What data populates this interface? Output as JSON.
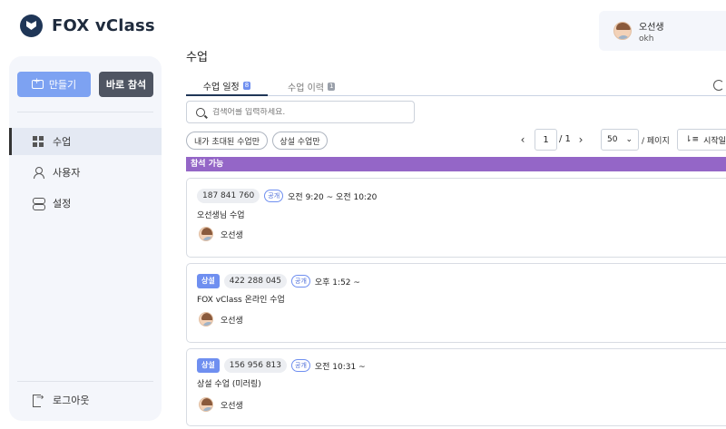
{
  "app": {
    "name": "FOX vClass"
  },
  "sidebar": {
    "make_label": "만들기",
    "join_label": "바로 참석",
    "nav": [
      {
        "label": "수업",
        "icon": "grid-icon",
        "active": true
      },
      {
        "label": "사용자",
        "icon": "user-icon",
        "active": false
      },
      {
        "label": "설정",
        "icon": "settings-icon",
        "active": false
      }
    ],
    "logout_label": "로그아웃"
  },
  "user": {
    "name": "오선생",
    "id": "okh"
  },
  "page": {
    "title": "수업"
  },
  "tabs": [
    {
      "label": "수업 일정",
      "count": "8",
      "active": true
    },
    {
      "label": "수업 이력",
      "count": "1",
      "active": false
    }
  ],
  "search": {
    "placeholder": "검색어를 입력하세요."
  },
  "filters": {
    "invited_label": "내가 초대된 수업만",
    "permanent_label": "상설 수업만"
  },
  "pagination": {
    "current": "1",
    "total": "/ 1",
    "page_size": "50",
    "per_page_label": "/ 페이지",
    "sort_label": "시작일 순"
  },
  "section": {
    "label": "참석 가능"
  },
  "classes": [
    {
      "permanent": false,
      "permanent_label": "",
      "room": "187 841 760",
      "visibility": "공개",
      "time": "오전 9:20 ~ 오전 10:20",
      "title": "오선생님 수업",
      "host": "오선생"
    },
    {
      "permanent": true,
      "permanent_label": "상설",
      "room": "422 288 045",
      "visibility": "공개",
      "time": "오후 1:52 ~",
      "title": "FOX vClass 온라인 수업",
      "host": "오선생"
    },
    {
      "permanent": true,
      "permanent_label": "상설",
      "room": "156 956 813",
      "visibility": "공개",
      "time": "오전 10:31 ~",
      "title": "상설 수업 (미러링)",
      "host": "오선생"
    }
  ],
  "colors": {
    "accent": "#7da2f2",
    "section": "#9466c7",
    "navy": "#1f3657"
  }
}
